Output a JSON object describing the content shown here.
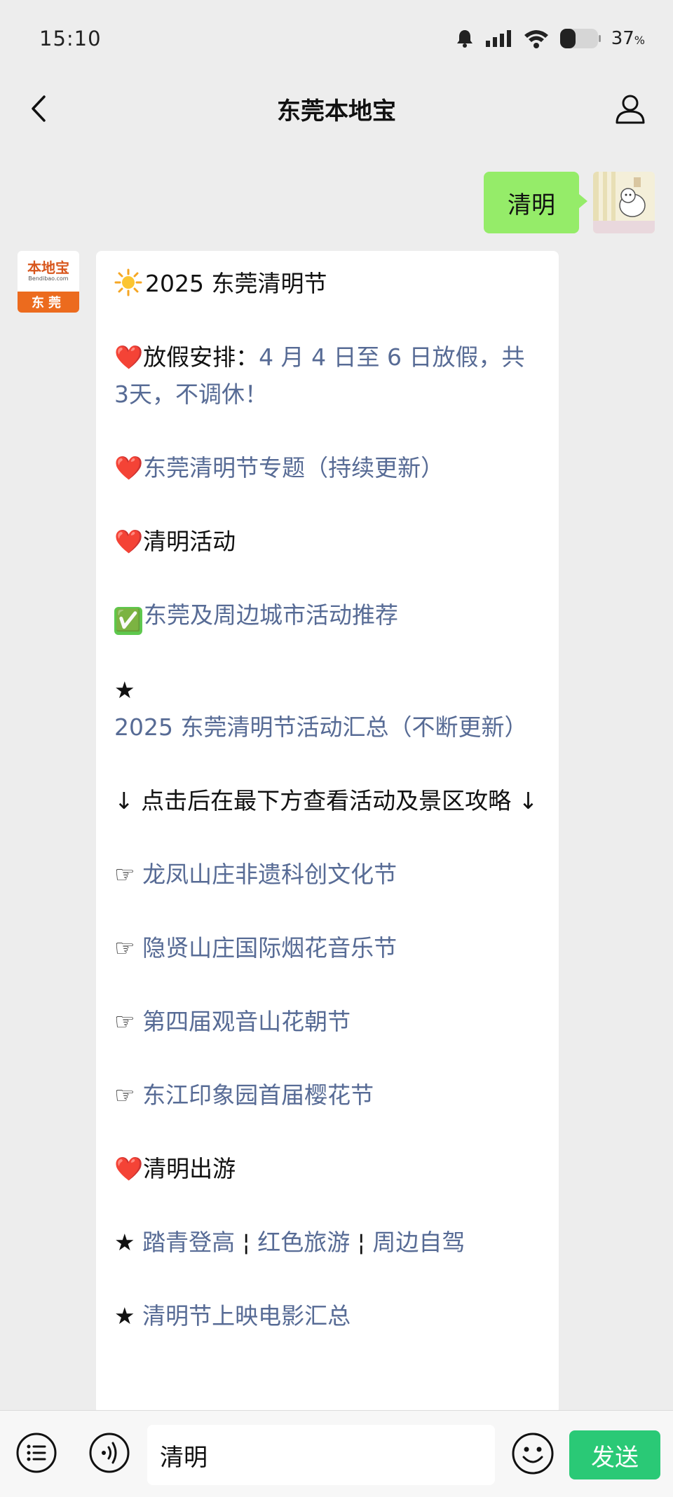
{
  "status_bar": {
    "time": "15:10",
    "battery_percent": "37",
    "battery_unit": "%",
    "battery_level": 0.37,
    "icons": [
      "bell-icon",
      "signal-icon",
      "wifi-icon",
      "battery-icon"
    ]
  },
  "nav": {
    "title": "东莞本地宝",
    "back_icon": "chevron-left-icon",
    "profile_icon": "person-icon"
  },
  "messages": {
    "outgoing": {
      "text": "清明"
    },
    "incoming": {
      "avatar": {
        "logo_cn": "本地宝",
        "logo_en": "Bendibao.com",
        "city": "东莞"
      },
      "lines": [
        {
          "prefix": "",
          "text": "2025 东莞清明节"
        },
        {
          "prefix": "❤️",
          "label": "放假安排：",
          "text": "4 月 4 日至 6 日放假，共 3天，不调休！"
        },
        {
          "prefix": "❤️",
          "text": "东莞清明节专题（持续更新）"
        },
        {
          "prefix": "❤️",
          "text": "清明活动"
        },
        {
          "prefix": "✅",
          "text": "东莞及周边城市活动推荐"
        },
        {
          "prefix": "★",
          "text": "2025 东莞清明节活动汇总（不断更新）"
        },
        {
          "prefix": "",
          "text": "↓ 点击后在最下方查看活动及景区攻略 ↓"
        },
        {
          "prefix": "☞",
          "text": "龙凤山庄非遗科创文化节"
        },
        {
          "prefix": "☞",
          "text": "隐贤山庄国际烟花音乐节"
        },
        {
          "prefix": "☞",
          "text": "第四届观音山花朝节"
        },
        {
          "prefix": "☞",
          "text": "东江印象园首届樱花节"
        },
        {
          "prefix": "❤️",
          "text": "清明出游"
        },
        {
          "prefix": "★",
          "text_a": "踏青登高",
          "sep1": "¦",
          "text_b": "红色旅游",
          "sep2": "¦",
          "text_c": "周边自驾"
        },
        {
          "prefix": "★",
          "text": "清明节上映电影汇总"
        }
      ]
    }
  },
  "input_bar": {
    "value": "清明",
    "send_label": "发送",
    "icons": [
      "menu-list-icon",
      "voice-icon",
      "emoji-icon"
    ]
  }
}
